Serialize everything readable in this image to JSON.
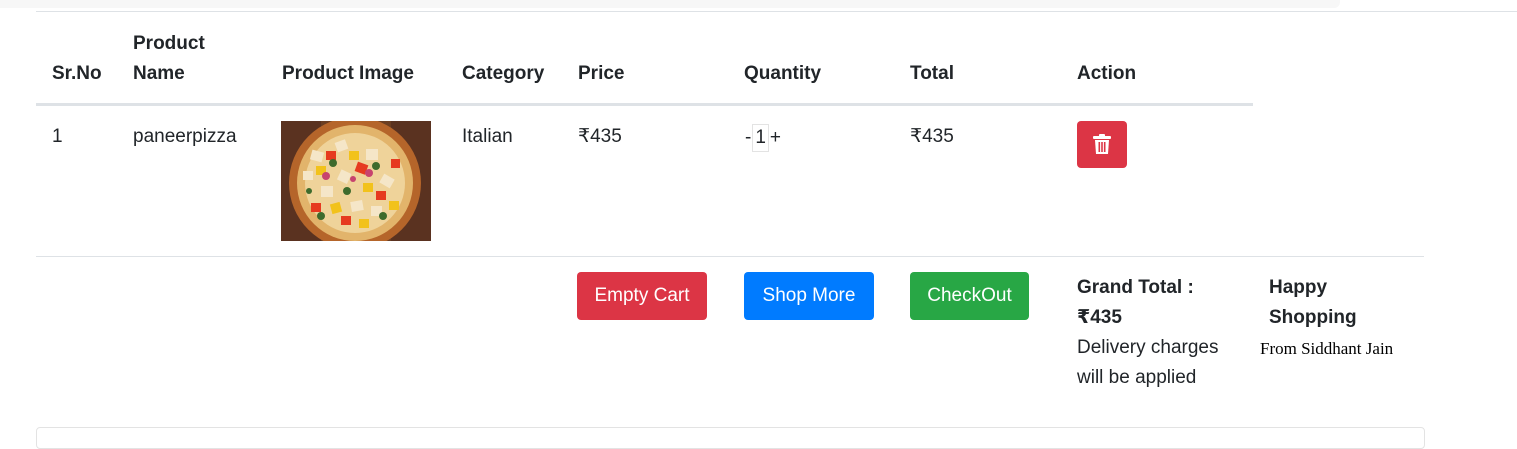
{
  "table": {
    "headers": {
      "sr_no": "Sr.No",
      "product_name": "Product Name",
      "product_image": "Product Image",
      "category": "Category",
      "price": "Price",
      "quantity": "Quantity",
      "total": "Total",
      "action": "Action"
    },
    "rows": [
      {
        "sr_no": "1",
        "product_name": "paneerpizza",
        "image_alt": "pizza-image",
        "category": "Italian",
        "price": "₹435",
        "quantity": {
          "minus": "-",
          "value": "1",
          "plus": "+"
        },
        "total": "₹435",
        "action_icon": "trash-icon"
      }
    ]
  },
  "footer": {
    "empty_cart_label": "Empty Cart",
    "shop_more_label": "Shop More",
    "checkout_label": "CheckOut",
    "grand_total_label": "Grand Total :",
    "grand_total_value": "₹435",
    "delivery_note": "Delivery charges will be applied",
    "happy_shopping": "Happy Shopping",
    "from_text": "From Siddhant Jain"
  },
  "colors": {
    "danger": "#dc3545",
    "primary": "#007bff",
    "success": "#28a745",
    "border": "#dee2e6"
  }
}
